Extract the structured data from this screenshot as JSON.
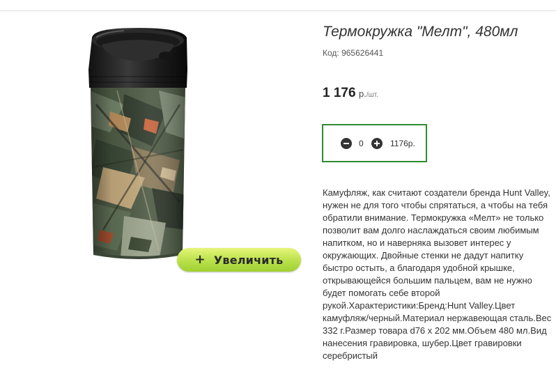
{
  "product": {
    "title": "Термокружка \"Мелт\", 480мл",
    "code": "Код: 965626441",
    "price_amount": "1 176",
    "price_currency": "р.",
    "price_unit": "/шт.",
    "quantity": "0",
    "total": "1176р.",
    "zoom_plus": "+",
    "zoom_label": "Увеличить",
    "description": "Камуфляж, как считают создатели бренда Hunt Valley, нужен не для того чтобы спрятаться, а чтобы на тебя обратили внимание. Термокружка «Мелт» не только позволит вам долго наслаждаться своим любимым напитком, но и наверняка вызовет интерес у окружающих. Двойные стенки не дадут напитку быстро остыть, а благодаря удобной крышке, открывающейся большим пальцем, вам не нужно будет помогать себе второй рукой.Характеристики:Бренд:Hunt Valley.Цвет камуфляж/черный.Материал нержавеющая сталь.Вес 332 г.Размер товара d76 x 202 мм.Объем 480 мл.Вид нанесения гравировка, шубер.Цвет гравировки серебристый"
  },
  "colors": {
    "accent_border": "#2e8b2e",
    "zoom_button": "#b9e04a"
  },
  "icons": {
    "minus": "minus-circle-icon",
    "plus": "plus-circle-icon"
  }
}
